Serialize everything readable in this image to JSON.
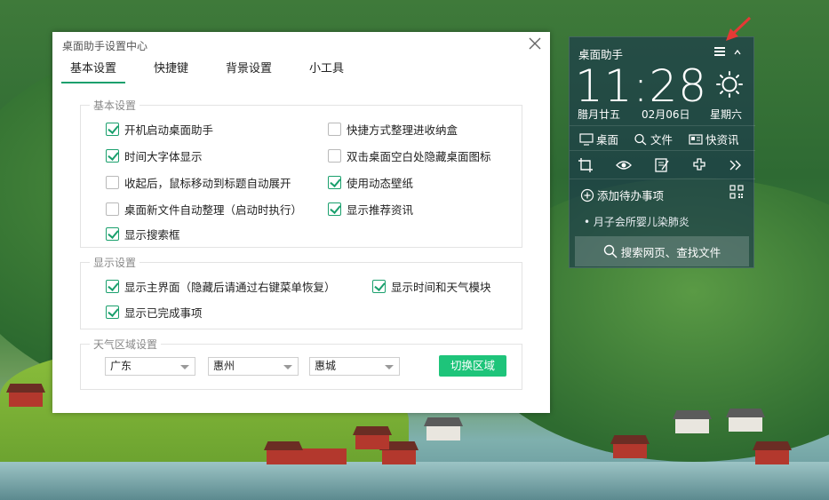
{
  "dialog": {
    "title": "桌面助手设置中心",
    "tabs": [
      "基本设置",
      "快捷键",
      "背景设置",
      "小工具"
    ],
    "active_tab": 0,
    "groups": {
      "basic": {
        "legend": "基本设置",
        "options": [
          {
            "label": "开机启动桌面助手",
            "checked": true
          },
          {
            "label": "快捷方式整理进收纳盒",
            "checked": false
          },
          {
            "label": "时间大字体显示",
            "checked": true
          },
          {
            "label": "双击桌面空白处隐藏桌面图标",
            "checked": false
          },
          {
            "label": "收起后，鼠标移动到标题自动展开",
            "checked": false
          },
          {
            "label": "使用动态壁纸",
            "checked": true
          },
          {
            "label": "桌面新文件自动整理（启动时执行）",
            "checked": false
          },
          {
            "label": "显示推荐资讯",
            "checked": true
          },
          {
            "label": "显示搜索框",
            "checked": true
          }
        ]
      },
      "display": {
        "legend": "显示设置",
        "options": [
          {
            "label": "显示主界面（隐藏后请通过右键菜单恢复）",
            "checked": true
          },
          {
            "label": "显示时间和天气模块",
            "checked": true
          },
          {
            "label": "显示已完成事项",
            "checked": true
          }
        ]
      },
      "weather": {
        "legend": "天气区域设置",
        "province": "广东",
        "city": "惠州",
        "district": "惠城",
        "switch_button": "切换区域"
      }
    }
  },
  "widget": {
    "title": "桌面助手",
    "time": "11:28",
    "lunar_date": "腊月廿五",
    "date": "02月06日",
    "weekday": "星期六",
    "links": [
      "桌面",
      "文件",
      "快资讯"
    ],
    "add_todo": "添加待办事项",
    "news_item": "月子会所婴儿染肺炎",
    "search_label": "搜索网页、查找文件"
  },
  "colors": {
    "accent_green": "#1aa06d",
    "button_green": "#1ec47a",
    "widget_bg": "#18344e",
    "pointer_arrow": "#e53935"
  }
}
